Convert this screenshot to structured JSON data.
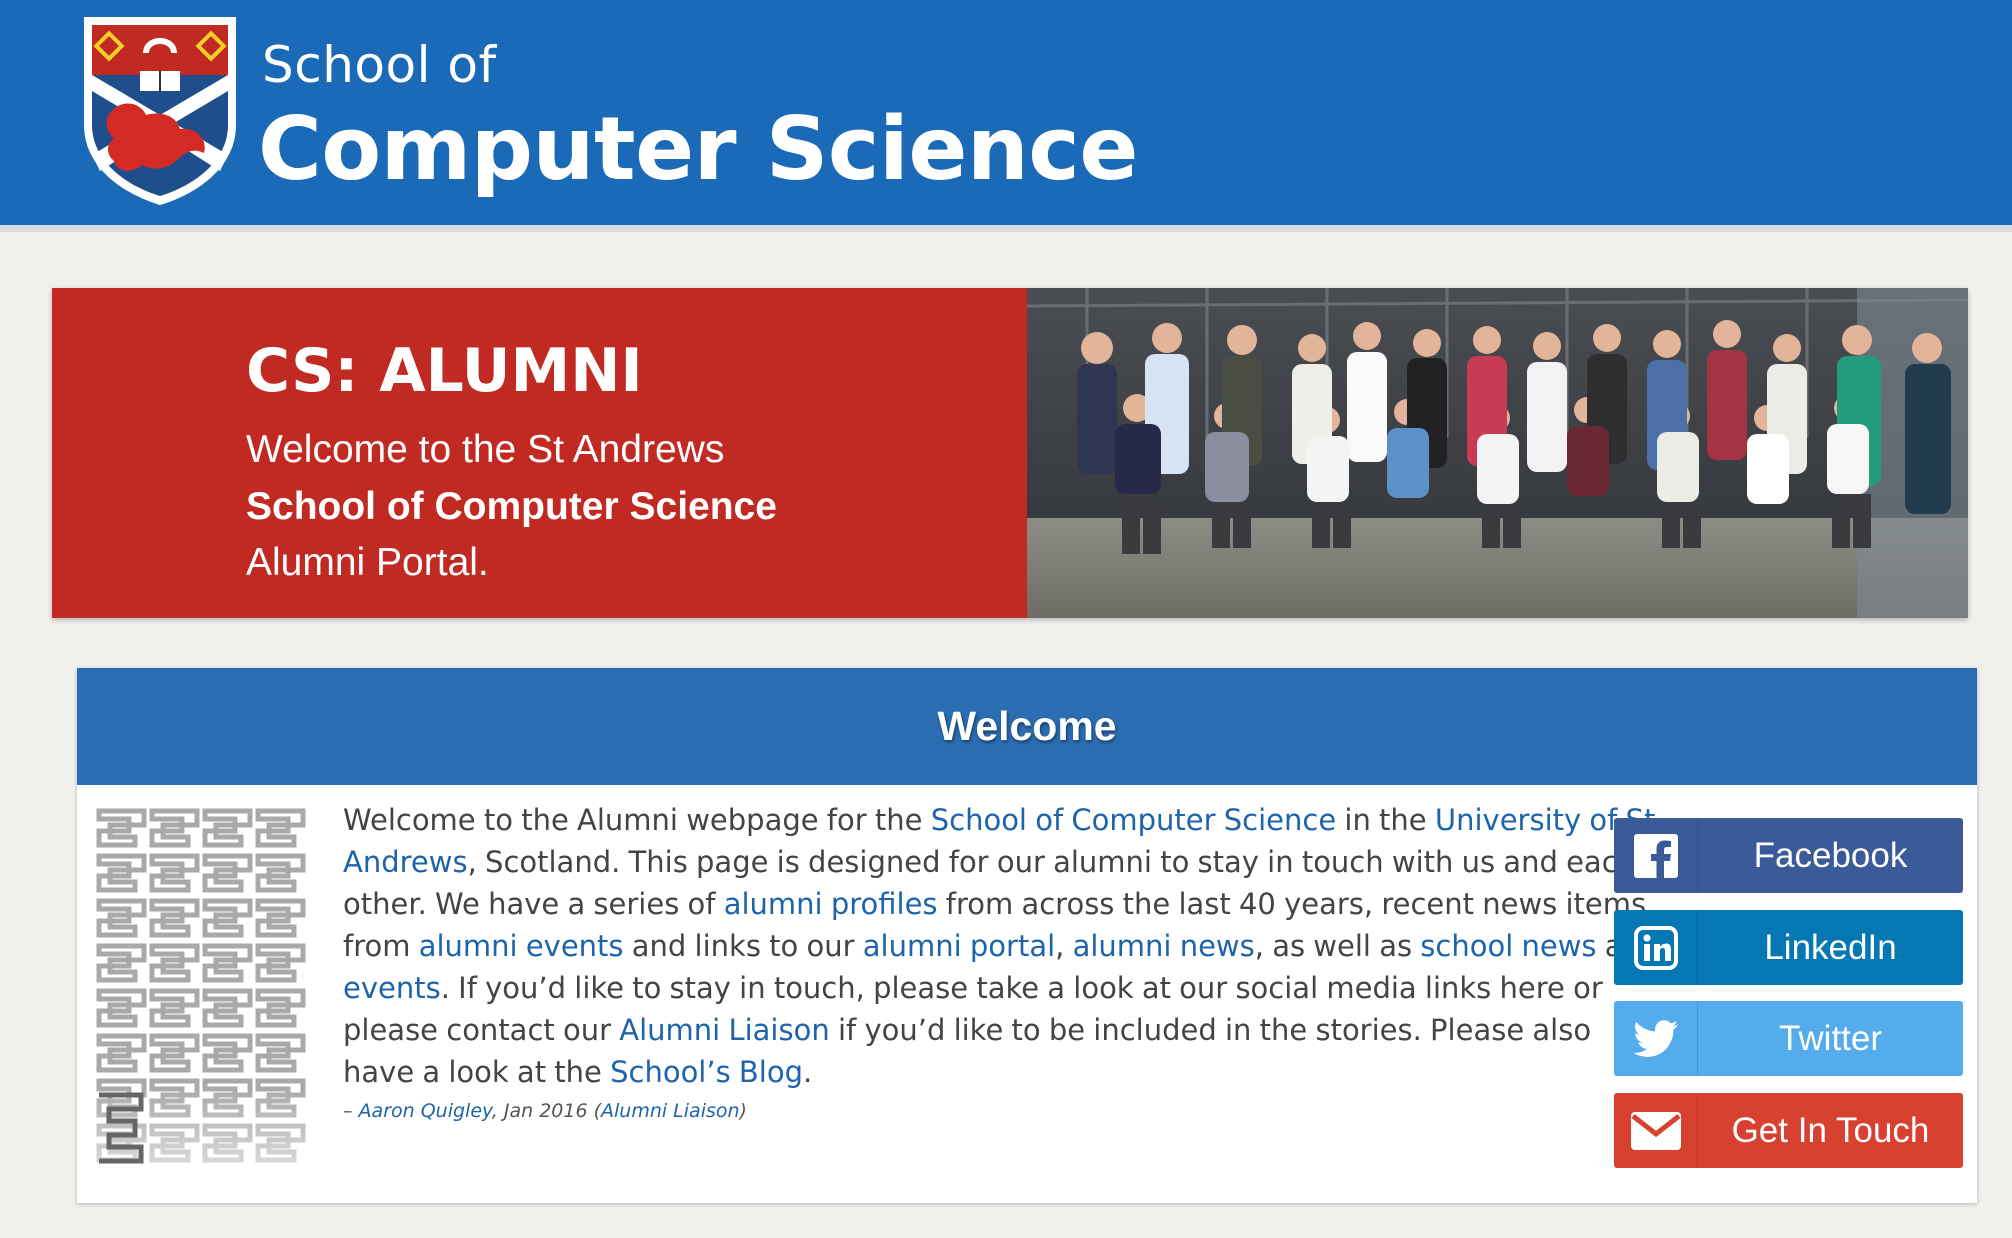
{
  "header": {
    "title_small": "School of",
    "title_big": "Computer Science"
  },
  "hero": {
    "title": "CS: ALUMNI",
    "line1": "Welcome to the St Andrews",
    "line2": "School of Computer Science",
    "line3": "Alumni Portal."
  },
  "welcome": {
    "heading": "Welcome",
    "intro": {
      "t1": "Welcome to the Alumni webpage for the ",
      "link_school": "School of Computer Science",
      "t2": " in the ",
      "link_university": "University of St Andrews",
      "t3": ", Scotland. This page is designed for our alumni to stay in touch with us and each other. We have a series of ",
      "link_profiles": "alumni profiles",
      "t4": " from across the last 40 years, recent news items from ",
      "link_alumni_events": "alumni events",
      "t5": " and links to our ",
      "link_portal": "alumni portal",
      "t6": ", ",
      "link_alumni_news": "alumni news",
      "t7": ", as well as ",
      "link_school_news": "school news",
      "t8": " and ",
      "link_events": "events",
      "t9": ". If you’d like to stay in touch, please take a look at our social media links here or please contact our ",
      "link_liaison": "Alumni Liaison",
      "t10": " if you’d like to be included in the stories. Please also have a look at the ",
      "link_blog": "School’s Blog",
      "t11": "."
    },
    "signature": {
      "dash": "– ",
      "author": "Aaron Quigley",
      "date": ", Jan 2016 (",
      "role": "Alumni Liaison",
      "close": ")"
    }
  },
  "social": [
    {
      "label": "Facebook",
      "icon": "facebook-icon",
      "color": "#3b5a98"
    },
    {
      "label": "LinkedIn",
      "icon": "linkedin-icon",
      "color": "#0577b3"
    },
    {
      "label": "Twitter",
      "icon": "twitter-icon",
      "color": "#54aced"
    },
    {
      "label": "Get In Touch",
      "icon": "envelope-icon",
      "color": "#d8402f"
    }
  ],
  "colors": {
    "header_blue": "#1b6ab7",
    "hero_red": "#c12a22",
    "card_header_blue": "#2b6db2",
    "link_blue": "#1d64ab",
    "page_bg": "#f1f0ec"
  }
}
